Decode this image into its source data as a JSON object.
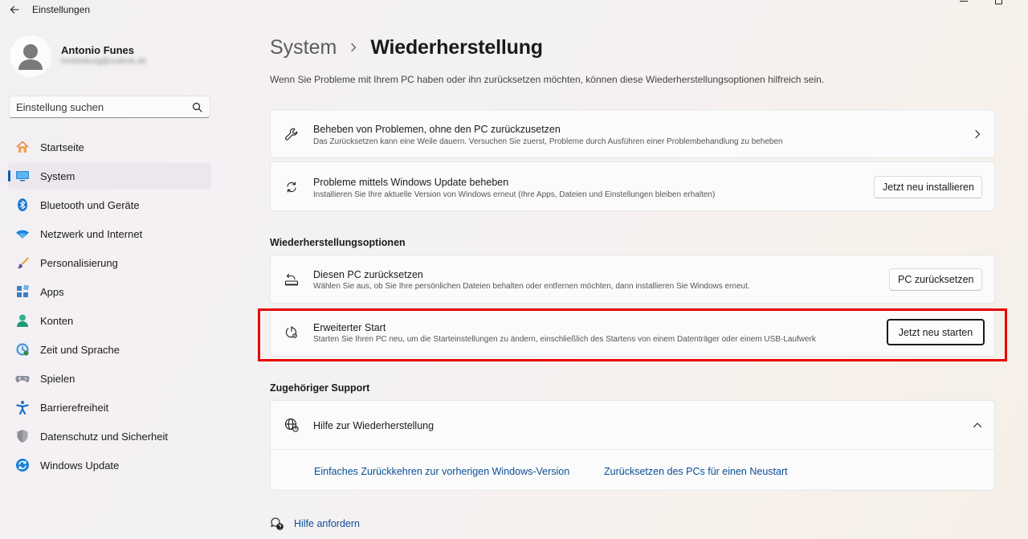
{
  "window": {
    "title": "Einstellungen"
  },
  "user": {
    "name": "Antonio Funes",
    "email": "herbitsburg@outlook.de"
  },
  "search": {
    "placeholder": "Einstellung suchen"
  },
  "sidebar": {
    "items": [
      {
        "label": "Startseite",
        "icon": "home-icon"
      },
      {
        "label": "System",
        "icon": "system-icon",
        "selected": true
      },
      {
        "label": "Bluetooth und Geräte",
        "icon": "bluetooth-icon"
      },
      {
        "label": "Netzwerk und Internet",
        "icon": "wifi-icon"
      },
      {
        "label": "Personalisierung",
        "icon": "brush-icon"
      },
      {
        "label": "Apps",
        "icon": "apps-icon"
      },
      {
        "label": "Konten",
        "icon": "account-icon"
      },
      {
        "label": "Zeit und Sprache",
        "icon": "time-language-icon"
      },
      {
        "label": "Spielen",
        "icon": "gaming-icon"
      },
      {
        "label": "Barrierefreiheit",
        "icon": "accessibility-icon"
      },
      {
        "label": "Datenschutz und Sicherheit",
        "icon": "shield-icon"
      },
      {
        "label": "Windows Update",
        "icon": "windows-update-icon"
      }
    ]
  },
  "breadcrumb": {
    "parent": "System",
    "current": "Wiederherstellung"
  },
  "intro": "Wenn Sie Probleme mit Ihrem PC haben oder ihn zurücksetzen möchten, können diese Wiederherstellungsoptionen hilfreich sein.",
  "cards": {
    "fix_problems": {
      "title": "Beheben von Problemen, ohne den PC zurückzusetzen",
      "desc": "Das Zurücksetzen kann eine Weile dauern. Versuchen Sie zuerst, Probleme durch Ausführen einer Problembehandlung zu beheben"
    },
    "windows_update": {
      "title": "Probleme mittels Windows Update beheben",
      "desc": "Installieren Sie Ihre aktuelle Version von Windows erneut (Ihre Apps, Dateien und Einstellungen bleiben erhalten)",
      "button": "Jetzt neu installieren"
    }
  },
  "recovery_options": {
    "heading": "Wiederherstellungsoptionen",
    "reset_pc": {
      "title": "Diesen PC zurücksetzen",
      "desc": "Wählen Sie aus, ob Sie Ihre persönlichen Dateien behalten oder entfernen möchten, dann installieren Sie Windows erneut.",
      "button": "PC zurücksetzen"
    },
    "advanced_start": {
      "title": "Erweiterter Start",
      "desc": "Starten Sie Ihren PC neu, um die Starteinstellungen zu ändern, einschließlich des Startens von einem Datenträger oder einem USB-Laufwerk",
      "button": "Jetzt neu starten"
    }
  },
  "support": {
    "heading": "Zugehöriger Support",
    "title": "Hilfe zur Wiederherstellung",
    "links": [
      "Einfaches Zurückkehren zur vorherigen Windows-Version",
      "Zurücksetzen des PCs für einen Neustart"
    ]
  },
  "help": {
    "label": "Hilfe anfordern"
  },
  "colors": {
    "accent": "#005fb8",
    "link": "#0a4f96",
    "highlight": "#e60000"
  }
}
